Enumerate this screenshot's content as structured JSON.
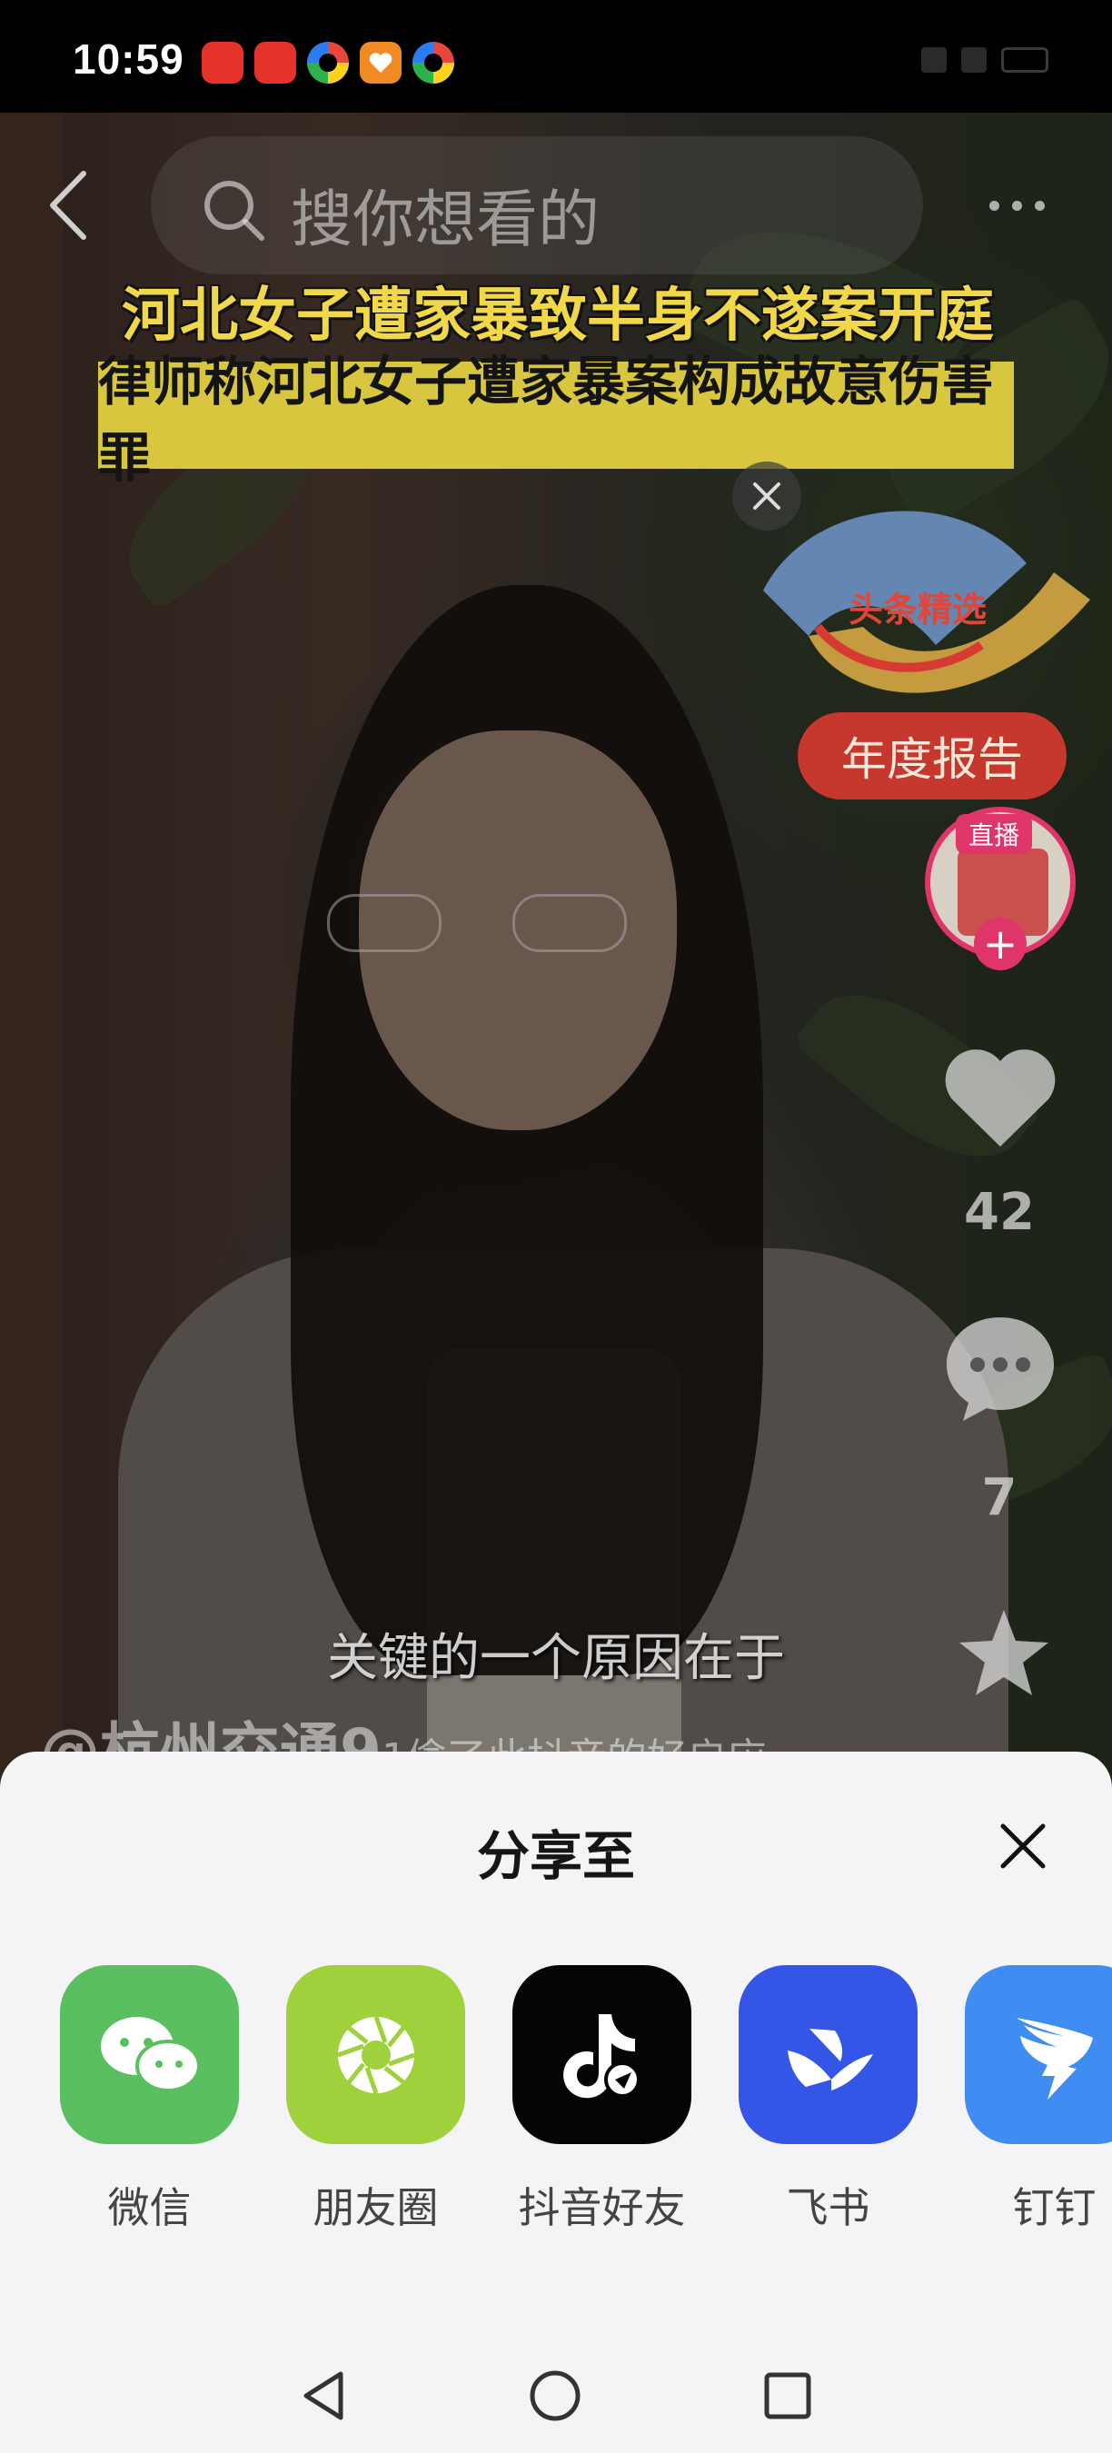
{
  "status_bar": {
    "time": "10:59",
    "apps": [
      "toutiao-app-icon",
      "toutiao-app-icon",
      "swirl-app-icon",
      "heart-app-icon",
      "swirl-app-icon"
    ]
  },
  "top_bar": {
    "search_placeholder": "搜你想看的"
  },
  "video": {
    "headline_1": "河北女子遭家暴致半身不遂案开庭",
    "headline_2": "律师称河北女子遭家暴案构成故意伤害罪",
    "subtitle": "关键的一个原因在于",
    "account": "@杭州交通9",
    "account_suffix": "1偷了此抖音的好启应"
  },
  "side_actions": {
    "ad_label": "头条精选",
    "report_button": "年度报告",
    "live_badge": "直播",
    "follow_plus": "+",
    "like_count": "42",
    "comment_count": "7"
  },
  "share_sheet": {
    "title": "分享至",
    "items": [
      {
        "label": "微信",
        "color": "#5ac05f",
        "icon": "wechat-icon"
      },
      {
        "label": "朋友圈",
        "color": "#9ed13b",
        "icon": "moments-icon"
      },
      {
        "label": "抖音好友",
        "color": "#050505",
        "icon": "douyin-icon"
      },
      {
        "label": "飞书",
        "color": "#3456e6",
        "icon": "feishu-icon"
      },
      {
        "label": "钉钉",
        "color": "#3f8cf2",
        "icon": "dingtalk-icon"
      }
    ]
  },
  "navbar": {
    "buttons": [
      "back-icon",
      "home-icon",
      "recents-icon"
    ]
  }
}
